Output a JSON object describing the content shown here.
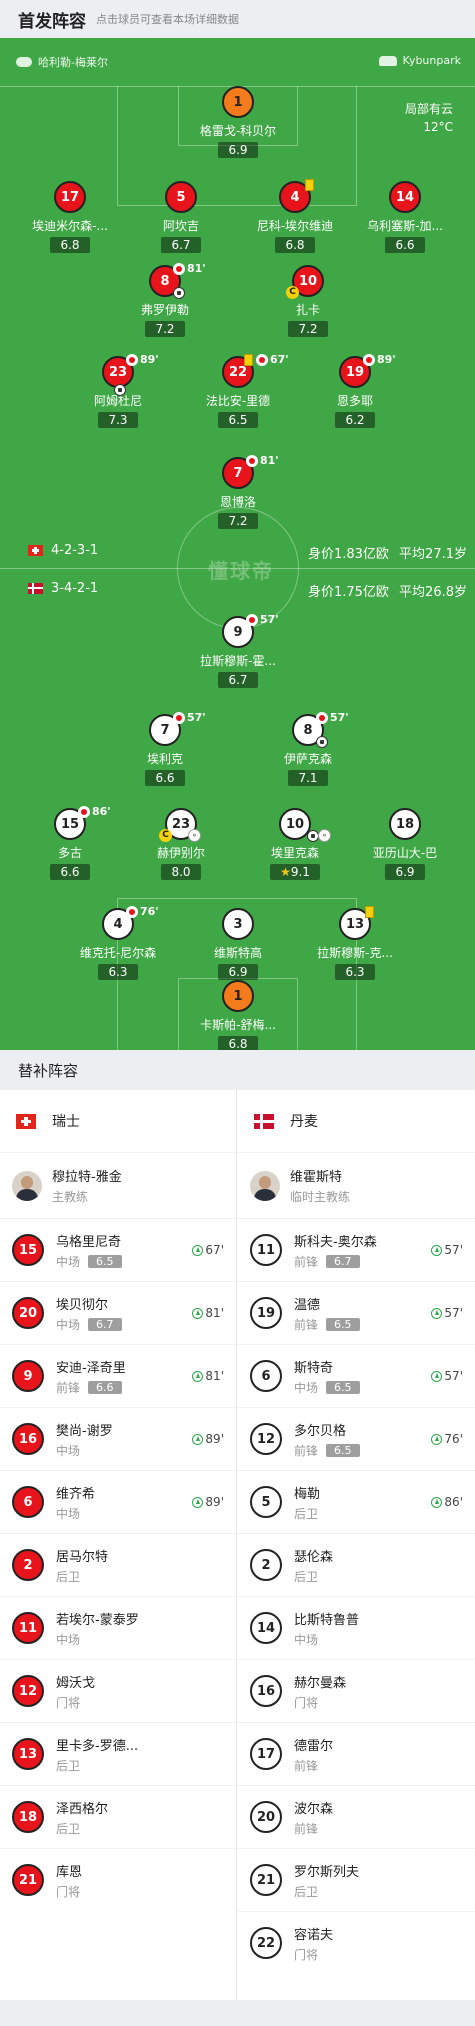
{
  "header": {
    "title": "首发阵容",
    "subtitle": "点击球员可查看本场详细数据"
  },
  "venue": {
    "referee": "哈利勒-梅莱尔",
    "stadium": "Kybunpark"
  },
  "weather": {
    "desc": "局部有云",
    "temp": "12°C"
  },
  "home": {
    "formation": "4-2-3-1",
    "value": "身价1.83亿欧",
    "avg_age": "平均27.1岁"
  },
  "away": {
    "formation": "3-4-2-1",
    "value": "身价1.75亿欧",
    "avg_age": "平均26.8岁"
  },
  "watermark": "懂球帝",
  "home_players": [
    {
      "num": "1",
      "name": "格雷戈-科贝尔",
      "rating": "6.9"
    },
    {
      "num": "17",
      "name": "埃迪米尔森-...",
      "rating": "6.8"
    },
    {
      "num": "5",
      "name": "阿坎吉",
      "rating": "6.7"
    },
    {
      "num": "4",
      "name": "尼科-埃尔维迪",
      "rating": "6.8"
    },
    {
      "num": "14",
      "name": "乌利塞斯-加...",
      "rating": "6.6"
    },
    {
      "num": "8",
      "name": "弗罗伊勒",
      "rating": "7.2",
      "sub": "81'"
    },
    {
      "num": "10",
      "name": "扎卡",
      "rating": "7.2"
    },
    {
      "num": "23",
      "name": "阿姆杜尼",
      "rating": "7.3",
      "sub": "89'"
    },
    {
      "num": "22",
      "name": "法比安-里德",
      "rating": "6.5",
      "sub": "67'"
    },
    {
      "num": "19",
      "name": "恩多耶",
      "rating": "6.2",
      "sub": "89'"
    },
    {
      "num": "7",
      "name": "恩博洛",
      "rating": "7.2",
      "sub": "81'"
    }
  ],
  "away_players": [
    {
      "num": "9",
      "name": "拉斯穆斯-霍...",
      "rating": "6.7",
      "sub": "57'"
    },
    {
      "num": "7",
      "name": "埃利克",
      "rating": "6.6",
      "sub": "57'"
    },
    {
      "num": "8",
      "name": "伊萨克森",
      "rating": "7.1",
      "sub": "57'"
    },
    {
      "num": "15",
      "name": "多古",
      "rating": "6.6",
      "sub": "86'"
    },
    {
      "num": "23",
      "name": "赫伊别尔",
      "rating": "8.0"
    },
    {
      "num": "10",
      "name": "埃里克森",
      "rating": "9.1"
    },
    {
      "num": "18",
      "name": "亚历山大-巴",
      "rating": "6.9"
    },
    {
      "num": "4",
      "name": "维克托-尼尔森",
      "rating": "6.3",
      "sub": "76'"
    },
    {
      "num": "3",
      "name": "维斯特高",
      "rating": "6.9"
    },
    {
      "num": "13",
      "name": "拉斯穆斯-克...",
      "rating": "6.3"
    },
    {
      "num": "1",
      "name": "卡斯帕-舒梅...",
      "rating": "6.8"
    }
  ],
  "subs_title": "替补阵容",
  "subs_home": {
    "team": "瑞士",
    "coach": {
      "name": "穆拉特-雅金",
      "role": "主教练"
    },
    "players": [
      {
        "num": "15",
        "name": "乌格里尼奇",
        "pos": "中场",
        "rating": "6.5",
        "in": "67'"
      },
      {
        "num": "20",
        "name": "埃贝彻尔",
        "pos": "中场",
        "rating": "6.7",
        "in": "81'"
      },
      {
        "num": "9",
        "name": "安迪-泽奇里",
        "pos": "前锋",
        "rating": "6.6",
        "in": "81'"
      },
      {
        "num": "16",
        "name": "樊尚-谢罗",
        "pos": "中场",
        "in": "89'"
      },
      {
        "num": "6",
        "name": "维齐希",
        "pos": "中场",
        "in": "89'"
      },
      {
        "num": "2",
        "name": "居马尔特",
        "pos": "后卫"
      },
      {
        "num": "11",
        "name": "若埃尔-蒙泰罗",
        "pos": "中场"
      },
      {
        "num": "12",
        "name": "姆沃戈",
        "pos": "门将"
      },
      {
        "num": "13",
        "name": "里卡多-罗德...",
        "pos": "后卫"
      },
      {
        "num": "18",
        "name": "泽西格尔",
        "pos": "后卫"
      },
      {
        "num": "21",
        "name": "库恩",
        "pos": "门将"
      }
    ]
  },
  "subs_away": {
    "team": "丹麦",
    "coach": {
      "name": "维霍斯特",
      "role": "临时主教练"
    },
    "players": [
      {
        "num": "11",
        "name": "斯科夫-奥尔森",
        "pos": "前锋",
        "rating": "6.7",
        "in": "57'"
      },
      {
        "num": "19",
        "name": "温德",
        "pos": "前锋",
        "rating": "6.5",
        "in": "57'"
      },
      {
        "num": "6",
        "name": "斯特奇",
        "pos": "中场",
        "rating": "6.5",
        "in": "57'"
      },
      {
        "num": "12",
        "name": "多尔贝格",
        "pos": "前锋",
        "rating": "6.5",
        "in": "76'"
      },
      {
        "num": "5",
        "name": "梅勒",
        "pos": "后卫",
        "in": "86'"
      },
      {
        "num": "2",
        "name": "瑟伦森",
        "pos": "后卫"
      },
      {
        "num": "14",
        "name": "比斯特鲁普",
        "pos": "中场"
      },
      {
        "num": "16",
        "name": "赫尔曼森",
        "pos": "门将"
      },
      {
        "num": "17",
        "name": "德雷尔",
        "pos": "前锋"
      },
      {
        "num": "20",
        "name": "波尔森",
        "pos": "前锋"
      },
      {
        "num": "21",
        "name": "罗尔斯列夫",
        "pos": "后卫"
      },
      {
        "num": "22",
        "name": "容诺夫",
        "pos": "门将"
      }
    ]
  }
}
